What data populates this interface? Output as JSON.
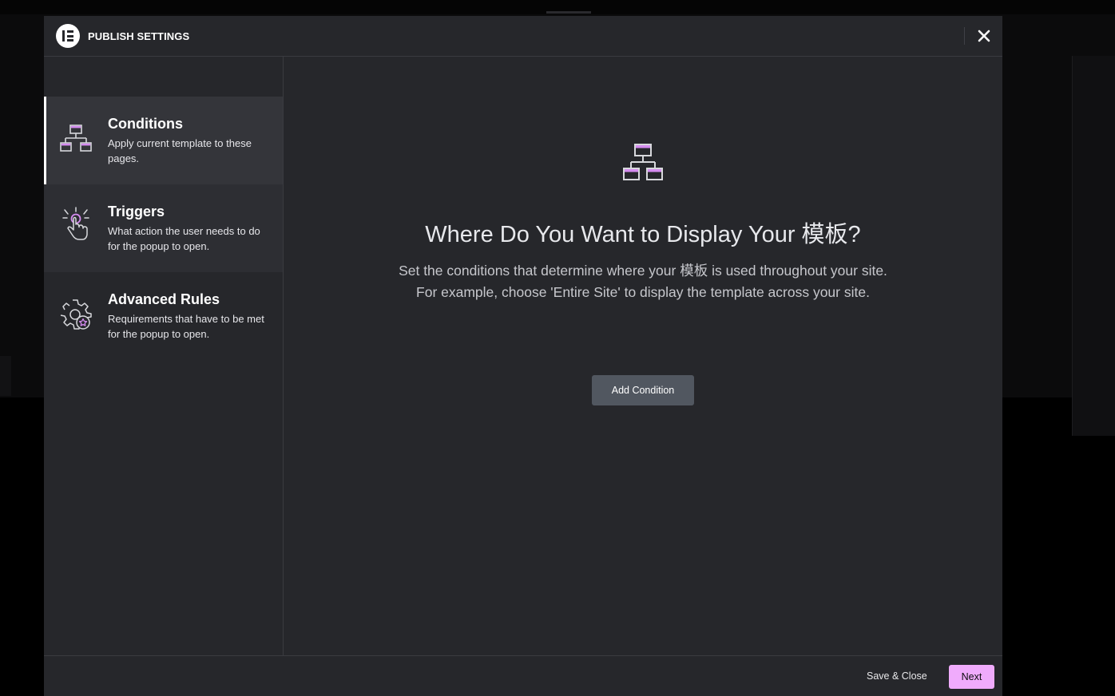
{
  "modal": {
    "title": "PUBLISH SETTINGS",
    "logo": "elementor-logo",
    "close_icon": "close-icon"
  },
  "sidebar": {
    "items": [
      {
        "title": "Conditions",
        "desc": "Apply current template to these pages.",
        "icon": "sitemap-icon",
        "active": true
      },
      {
        "title": "Triggers",
        "desc": "What action the user needs to do for the popup to open.",
        "icon": "hand-click-icon",
        "active": false
      },
      {
        "title": "Advanced Rules",
        "desc": "Requirements that have to be met for the popup to open.",
        "icon": "gear-star-icon",
        "active": false
      }
    ]
  },
  "main": {
    "icon": "sitemap-icon",
    "title": "Where Do You Want to Display Your 模板?",
    "desc_line1": "Set the conditions that determine where your 模板 is used throughout your site.",
    "desc_line2": "For example, choose 'Entire Site' to display the template across your site.",
    "add_button": "Add Condition"
  },
  "footer": {
    "save_close": "Save & Close",
    "next": "Next"
  },
  "colors": {
    "modal_bg": "#26272b",
    "accent_pink": "#f0abfc",
    "button_grey": "#515760"
  }
}
